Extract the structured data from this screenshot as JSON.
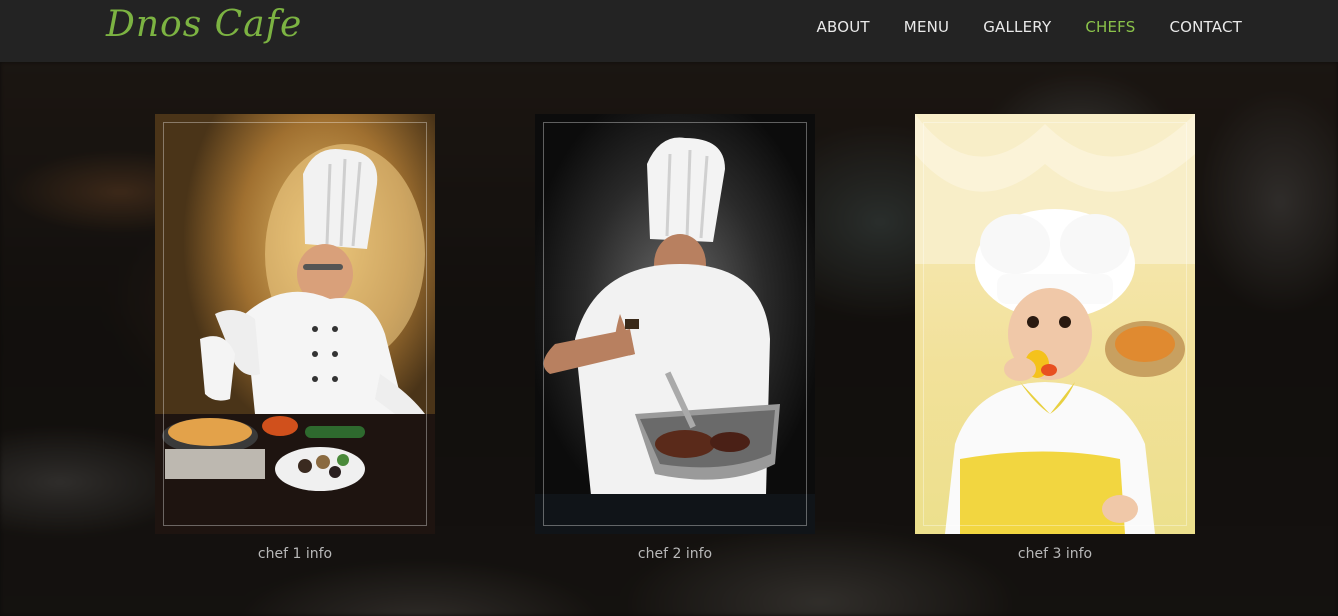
{
  "brand": "Dnos Cafe",
  "nav": [
    {
      "label": "ABOUT",
      "active": false
    },
    {
      "label": "MENU",
      "active": false
    },
    {
      "label": "GALLERY",
      "active": false
    },
    {
      "label": "CHEFS",
      "active": true
    },
    {
      "label": "CONTACT",
      "active": false
    }
  ],
  "chefs": [
    {
      "caption": "chef 1 info"
    },
    {
      "caption": "chef 2 info"
    },
    {
      "caption": "chef 3 info"
    }
  ],
  "colors": {
    "accent": "#7cb342",
    "nav_active": "#8bc34a",
    "navbar_bg": "#232323"
  }
}
